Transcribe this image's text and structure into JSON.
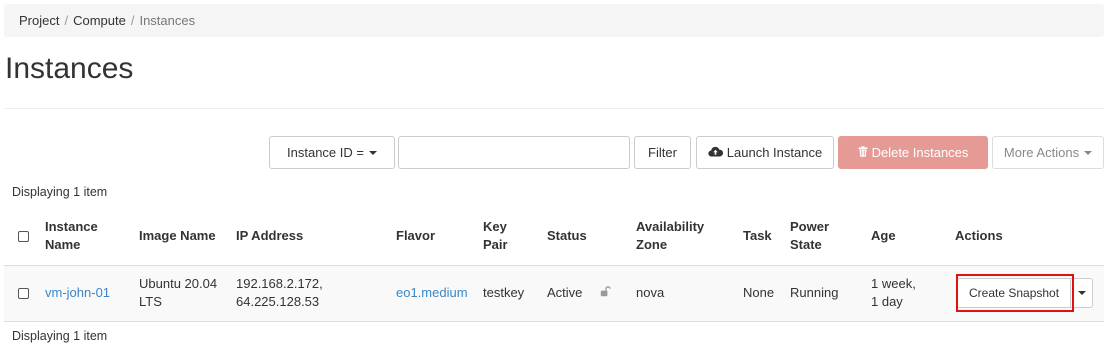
{
  "breadcrumb": {
    "items": [
      {
        "label": "Project"
      },
      {
        "label": "Compute"
      },
      {
        "label": "Instances"
      }
    ],
    "separator": "/"
  },
  "page_title": "Instances",
  "toolbar": {
    "filter_field_label": "Instance ID =",
    "search_value": "",
    "filter_label": "Filter",
    "launch_label": "Launch Instance",
    "launch_icon": "cloud-upload-icon",
    "delete_label": "Delete Instances",
    "delete_icon": "trash-icon",
    "more_actions_label": "More Actions"
  },
  "display_count_top": "Displaying 1 item",
  "display_count_bottom": "Displaying 1 item",
  "table": {
    "headers": {
      "name": "Instance Name",
      "image": "Image Name",
      "ip": "IP Address",
      "flavor": "Flavor",
      "keypair": "Key Pair",
      "status": "Status",
      "zone": "Availability Zone",
      "task": "Task",
      "power": "Power State",
      "age": "Age",
      "actions": "Actions"
    },
    "rows": [
      {
        "name": "vm-john-01",
        "image": "Ubuntu 20.04 LTS",
        "ip_1": "192.168.2.172,",
        "ip_2": "64.225.128.53",
        "flavor": "eo1.medium",
        "keypair": "testkey",
        "status": "Active",
        "zone": "nova",
        "task": "None",
        "power": "Running",
        "age_1": "1 week,",
        "age_2": "1 day",
        "action_primary": "Create Snapshot"
      }
    ]
  },
  "colors": {
    "link": "#3a87c8",
    "danger_button": "#e59a95",
    "highlight": "#e01111"
  }
}
